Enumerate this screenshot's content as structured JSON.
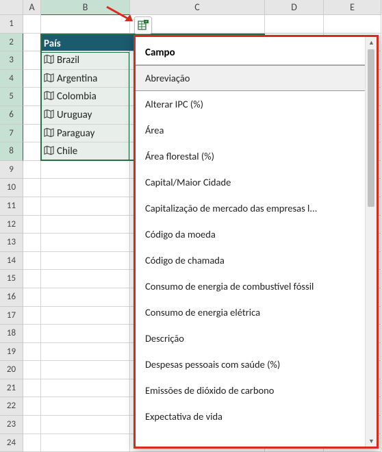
{
  "columns": {
    "A": "A",
    "B": "B",
    "C": "C",
    "D": "D",
    "E": "E"
  },
  "header_cell": "País",
  "row_numbers": [
    1,
    2,
    3,
    4,
    5,
    6,
    7,
    8,
    9,
    10,
    11,
    12,
    13,
    14,
    15,
    16,
    17,
    18,
    19,
    20,
    21,
    22,
    23,
    24
  ],
  "countries": [
    "Brazil",
    "Argentina",
    "Colombia",
    "Uruguay",
    "Paraguay",
    "Chile"
  ],
  "popup": {
    "title": "Campo",
    "items": [
      "Abreviação",
      "Alterar IPC (%)",
      "Área",
      "Área florestal (%)",
      "Capital/Maior Cidade",
      "Capitalização de mercado das empresas l...",
      "Código da moeda",
      "Código de chamada",
      "Consumo de energia de combustível fóssil",
      "Consumo de energia elétrica",
      "Descrição",
      "Despesas pessoais com saúde (%)",
      "Emissões de dióxido de carbono",
      "Expectativa de vida"
    ]
  }
}
